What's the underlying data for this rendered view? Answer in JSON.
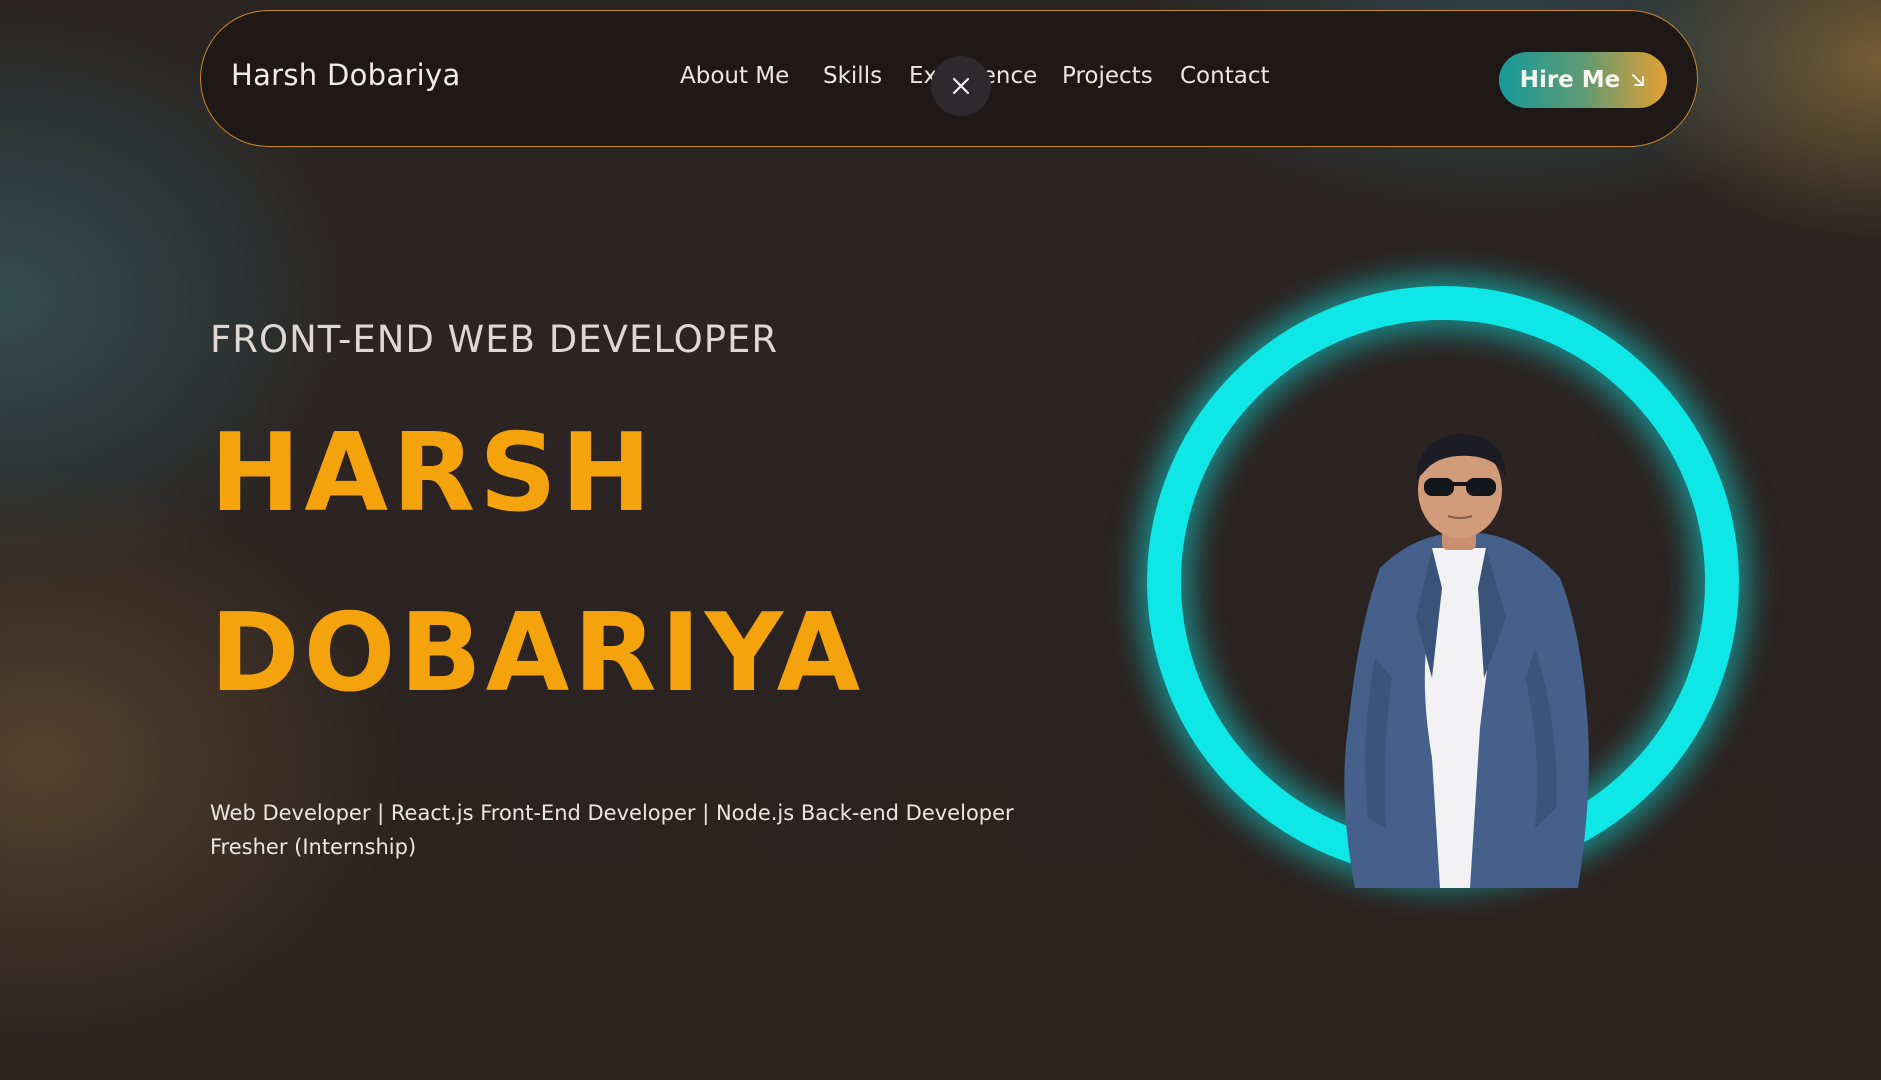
{
  "navbar": {
    "brand": "Harsh Dobariya",
    "links": [
      {
        "label": "About Me"
      },
      {
        "label": "Skills"
      },
      {
        "label": "Experience"
      },
      {
        "label": "Projects"
      },
      {
        "label": "Contact"
      }
    ],
    "hire_label": "Hire Me",
    "hire_icon": "arrow-down-right-icon",
    "close_icon": "close-icon"
  },
  "hero": {
    "subtitle": "FRONT-END WEB DEVELOPER",
    "first_name": "HARSH",
    "last_name": "DOBARIYA",
    "tagline_line1": "Web Developer | React.js Front-End Developer | Node.js Back-end Developer",
    "tagline_line2": "Fresher (Internship)"
  },
  "colors": {
    "accent": "#f5a30c",
    "ring": "#0fe6e6",
    "border": "#c8862a"
  }
}
